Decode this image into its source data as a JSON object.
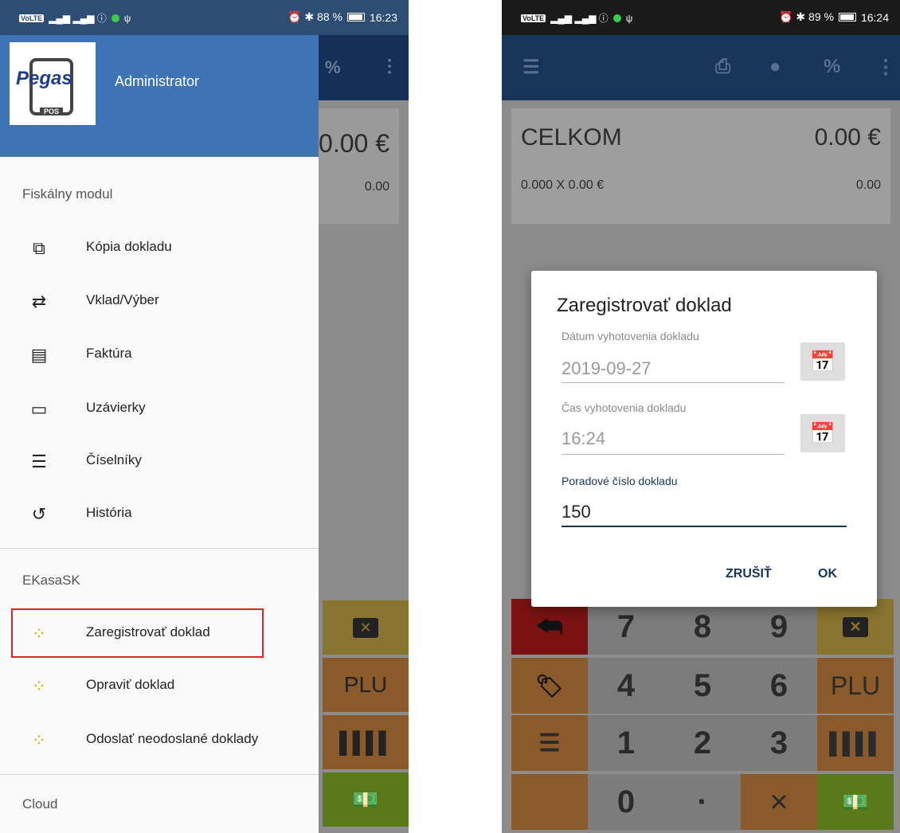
{
  "left_screen": {
    "status_bar": {
      "left_icons": "VoLTE 4G",
      "right_text": "⏰ ✱ 88 %",
      "time": "16:23"
    },
    "background": {
      "total_value": "0.00 €",
      "sub_value": "0.00"
    },
    "drawer": {
      "user": "Administrator",
      "logo_text": "Pegas",
      "logo_badge": "POS",
      "sections": [
        {
          "title": "Fiskálny modul",
          "items": [
            {
              "label": "Kópia dokladu",
              "icon": "copy-icon"
            },
            {
              "label": "Vklad/Výber",
              "icon": "swap-icon"
            },
            {
              "label": "Faktúra",
              "icon": "invoice-icon"
            },
            {
              "label": "Uzávierky",
              "icon": "closing-icon"
            },
            {
              "label": "Číselníky",
              "icon": "list-icon"
            },
            {
              "label": "História",
              "icon": "history-icon"
            }
          ]
        },
        {
          "title": "EKasaSK",
          "items": [
            {
              "label": "Zaregistrovať doklad",
              "icon": "ekasa-icon"
            },
            {
              "label": "Opraviť doklad",
              "icon": "ekasa-icon"
            },
            {
              "label": "Odoslať neodoslané doklady",
              "icon": "ekasa-icon"
            }
          ]
        },
        {
          "title": "Cloud",
          "items": []
        }
      ]
    },
    "keys": {
      "plu": "PLU"
    }
  },
  "right_screen": {
    "status_bar": {
      "left_icons": "VoLTE 4G",
      "right_text": "⏰ ✱ 89 %",
      "time": "16:24"
    },
    "summary": {
      "label": "CELKOM",
      "value": "0.00 €",
      "qty_line": "0.000  X  0.00  €",
      "qty_value": "0.00"
    },
    "dialog": {
      "title": "Zaregistrovať doklad",
      "date_label": "Dátum vyhotovenia dokladu",
      "date_value": "2019-09-27",
      "time_label": "Čas vyhotovenia dokladu",
      "time_value": "16:24",
      "number_label": "Poradové číslo dokladu",
      "number_value": "150",
      "cancel": "ZRUŠIŤ",
      "ok": "OK"
    },
    "keypad": [
      "7",
      "8",
      "9",
      "4",
      "5",
      "6",
      "1",
      "2",
      "3",
      "0",
      "·",
      "×"
    ],
    "plu": "PLU",
    "colors": {
      "red": "#b31b1b",
      "orange": "#d08a3c",
      "grey": "#a8a8a8",
      "green": "#7ab52d",
      "navy": "#173559"
    }
  }
}
